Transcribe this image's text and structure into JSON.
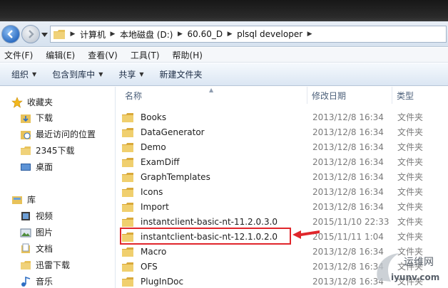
{
  "address": {
    "crumbs": [
      "计算机",
      "本地磁盘 (D:)",
      "60.60_D",
      "plsql developer"
    ]
  },
  "menu": [
    "文件(F)",
    "编辑(E)",
    "查看(V)",
    "工具(T)",
    "帮助(H)"
  ],
  "toolbar": {
    "organize": "组织",
    "include_in_library": "包含到库中",
    "share": "共享",
    "new_folder": "新建文件夹"
  },
  "nav": {
    "favorites": "收藏夹",
    "downloads": "下载",
    "recent_places": "最近访问的位置",
    "downloads_2345": "2345下载",
    "desktop": "桌面",
    "libraries": "库",
    "videos": "视频",
    "pictures": "图片",
    "documents": "文档",
    "xunlei_downloads": "迅雷下载",
    "music": "音乐"
  },
  "columns": {
    "name": "名称",
    "modified": "修改日期",
    "type": "类型"
  },
  "files": [
    {
      "name": "Books",
      "date": "2013/12/8 16:34",
      "type": "文件夹"
    },
    {
      "name": "DataGenerator",
      "date": "2013/12/8 16:34",
      "type": "文件夹"
    },
    {
      "name": "Demo",
      "date": "2013/12/8 16:34",
      "type": "文件夹"
    },
    {
      "name": "ExamDiff",
      "date": "2013/12/8 16:34",
      "type": "文件夹"
    },
    {
      "name": "GraphTemplates",
      "date": "2013/12/8 16:34",
      "type": "文件夹"
    },
    {
      "name": "Icons",
      "date": "2013/12/8 16:34",
      "type": "文件夹"
    },
    {
      "name": "Import",
      "date": "2013/12/8 16:34",
      "type": "文件夹"
    },
    {
      "name": "instantclient-basic-nt-11.2.0.3.0",
      "date": "2015/11/10 22:33",
      "type": "文件夹"
    },
    {
      "name": "instantclient-basic-nt-12.1.0.2.0",
      "date": "2015/11/11 1:04",
      "type": "文件夹"
    },
    {
      "name": "Macro",
      "date": "2013/12/8 16:34",
      "type": "文件夹"
    },
    {
      "name": "OFS",
      "date": "2013/12/8 16:34",
      "type": "文件夹"
    },
    {
      "name": "PlugInDoc",
      "date": "2013/12/8 16:34",
      "type": "文件夹"
    }
  ],
  "watermark": {
    "line1": "运维网",
    "line2": "iyunv.com"
  },
  "colors": {
    "folder": "#e8c25a",
    "highlight": "#e0262b",
    "nav_accent": "#2f6fc4"
  }
}
